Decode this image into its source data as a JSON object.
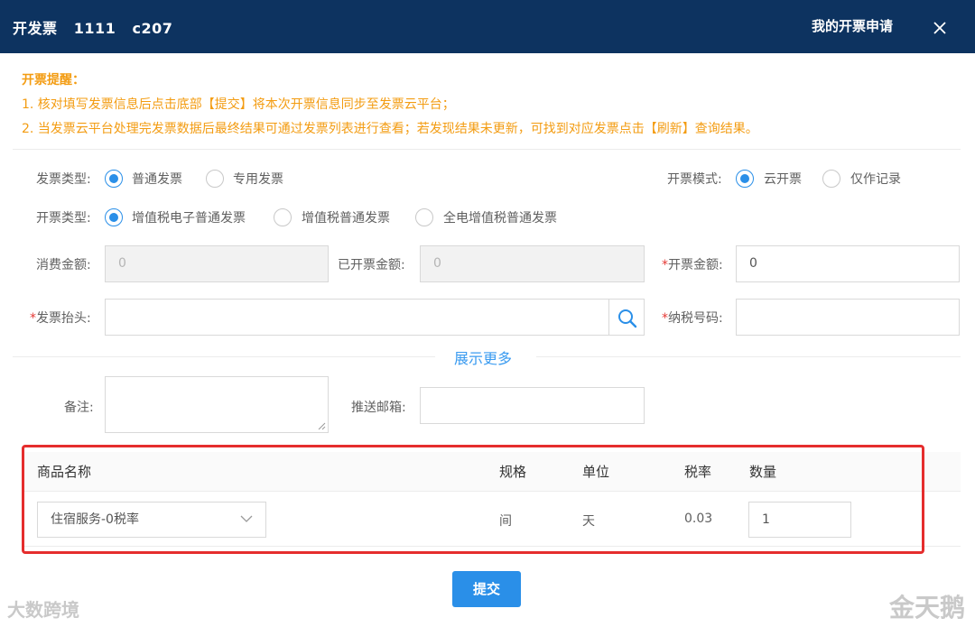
{
  "header": {
    "title": "开发票   1111   c207",
    "right_link": "我的开票申请"
  },
  "notice": {
    "title": "开票提醒：",
    "line1": "1. 核对填写发票信息后点击底部【提交】将本次开票信息同步至发票云平台；",
    "line2": "2. 当发票云平台处理完发票数据后最终结果可通过发票列表进行查看；若发现结果未更新，可找到对应发票点击【刷新】查询结果。"
  },
  "form": {
    "invoice_type_label": "发票类型:",
    "invoice_type_options": [
      "普通发票",
      "专用发票"
    ],
    "mode_label": "开票模式:",
    "mode_options": [
      "云开票",
      "仅作记录"
    ],
    "kind_label": "开票类型:",
    "kind_options": [
      "增值税电子普通发票",
      "增值税普通发票",
      "全电增值税普通发票"
    ],
    "consume_label": "消费金额:",
    "consume_value": "0",
    "issued_label": "已开票金额:",
    "issued_value": "0",
    "amount_label": "开票金额:",
    "amount_value": "0",
    "invoice_title_label": "发票抬头:",
    "tax_no_label": "纳税号码:",
    "show_more": "展示更多",
    "remark_label": "备注:",
    "email_label": "推送邮箱:"
  },
  "table": {
    "headers": [
      "商品名称",
      "规格",
      "单位",
      "税率",
      "数量"
    ],
    "row": {
      "product": "住宿服务-0税率",
      "spec": "间",
      "unit": "天",
      "tax_rate": "0.03",
      "quantity": "1"
    }
  },
  "submit_label": "提交",
  "watermark_left": "大数跨境",
  "watermark_right": "金天鹅",
  "colors": {
    "header_bg": "#0d3360",
    "accent": "#2a8fe8",
    "notice": "#f39c12",
    "required": "#e53935",
    "highlight": "#e52d2d"
  }
}
